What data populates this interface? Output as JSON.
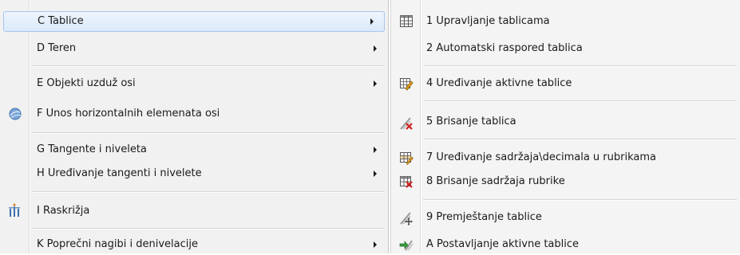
{
  "left_menu": {
    "items": [
      {
        "label": "C Tablice",
        "has_submenu": true,
        "highlighted": true
      },
      {
        "label": "D Teren",
        "has_submenu": true
      },
      {
        "label": "E Objekti uzduž osi",
        "has_submenu": true
      },
      {
        "label": "F Unos horizontalnih elemenata osi",
        "has_submenu": false,
        "icon": "globe-axis-icon"
      },
      {
        "label": "G Tangente i niveleta",
        "has_submenu": true
      },
      {
        "label": "H Uređivanje tangenti i nivelete",
        "has_submenu": true
      },
      {
        "label": "I Raskrižja",
        "has_submenu": false,
        "icon": "intersection-icon"
      },
      {
        "label": "K Poprečni nagibi i denivelacije",
        "has_submenu": true
      }
    ]
  },
  "right_menu": {
    "items": [
      {
        "label": "1 Upravljanje tablicama",
        "icon": "table-grid-icon"
      },
      {
        "label": "2 Automatski raspored tablica"
      },
      {
        "label": "4 Uređivanje aktivne tablice",
        "icon": "edit-table-icon"
      },
      {
        "label": "5 Brisanje tablica",
        "icon": "delete-table-icon"
      },
      {
        "label": "7 Uređivanje sadržaja\\decimala u rubrikama",
        "icon": "edit-cells-icon"
      },
      {
        "label": "8 Brisanje sadržaja rubrike",
        "icon": "delete-cell-content-icon"
      },
      {
        "label": "9 Premještanje tablice",
        "icon": "move-table-icon"
      },
      {
        "label": "A Postavljanje aktivne tablice",
        "icon": "set-active-table-icon"
      }
    ]
  },
  "colors": {
    "menu_bg": "#f1f1f1",
    "highlight_border": "#a8c6ec",
    "highlight_fill": "#dbe9f9"
  }
}
